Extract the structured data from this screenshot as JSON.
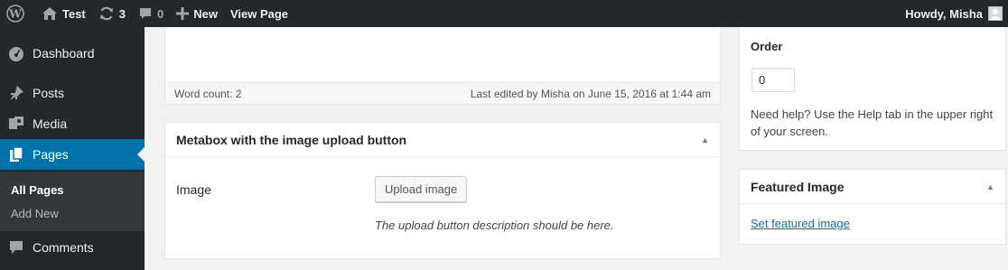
{
  "admin_bar": {
    "site_name": "Test",
    "updates_count": "3",
    "comments_count": "0",
    "new_label": "New",
    "view_page_label": "View Page",
    "greeting": "Howdy, Misha"
  },
  "sidebar": {
    "items": [
      {
        "label": "Dashboard",
        "icon": "dashboard-icon"
      },
      {
        "label": "Posts",
        "icon": "pin-icon"
      },
      {
        "label": "Media",
        "icon": "media-icon"
      },
      {
        "label": "Pages",
        "icon": "pages-icon",
        "current": true
      },
      {
        "label": "Comments",
        "icon": "comment-icon"
      }
    ],
    "submenu": [
      {
        "label": "All Pages",
        "current": true
      },
      {
        "label": "Add New"
      }
    ]
  },
  "editor": {
    "word_count": "Word count: 2",
    "last_edited": "Last edited by Misha on June 15, 2016 at 1:44 am"
  },
  "metabox": {
    "title": "Metabox with the image upload button",
    "field_label": "Image",
    "button_label": "Upload image",
    "description": "The upload button description should be here."
  },
  "page_attributes": {
    "order_label": "Order",
    "order_value": "0",
    "help_text": "Need help? Use the Help tab in the upper right of your screen."
  },
  "featured_image": {
    "title": "Featured Image",
    "link": "Set featured image"
  },
  "colors": {
    "admin_bar": "#23282d",
    "sidebar": "#23282d",
    "accent": "#0073aa",
    "background": "#f1f1f1"
  }
}
